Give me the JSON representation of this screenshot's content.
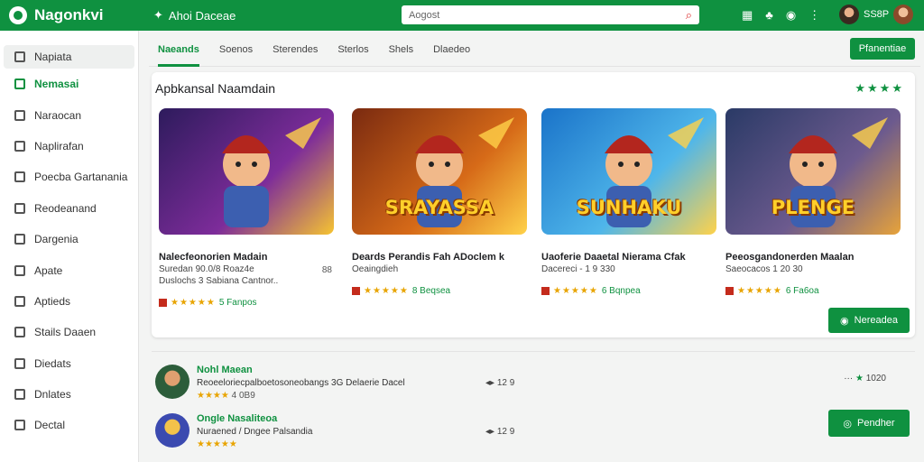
{
  "app": {
    "title": "Nagonkvi"
  },
  "topbar": {
    "crumb_label": "Ahoi Daceae",
    "search_placeholder": "Aogost",
    "user_label": "SS8P"
  },
  "sidebar": {
    "items": [
      {
        "label": "Napiata",
        "icon": "grid-icon"
      },
      {
        "label": "Nemasai",
        "icon": "apps-icon"
      },
      {
        "label": "Naraocan",
        "icon": "tv-icon"
      },
      {
        "label": "Naplirafan",
        "icon": "book-icon"
      },
      {
        "label": "Poecba Gartanania",
        "icon": "tag-icon"
      },
      {
        "label": "Reodeanand",
        "icon": "user-icon"
      },
      {
        "label": "Dargenia",
        "icon": "chart-icon"
      },
      {
        "label": "Apate",
        "icon": "mail-icon"
      },
      {
        "label": "Aptieds",
        "icon": "circle-icon"
      },
      {
        "label": "Stails Daaen",
        "icon": "bag-icon"
      },
      {
        "label": "Diedats",
        "icon": "shield-icon"
      },
      {
        "label": "Dnlates",
        "icon": "flag-icon"
      },
      {
        "label": "Dectal",
        "icon": "pen-icon"
      }
    ]
  },
  "tabs": [
    {
      "label": "Naeands"
    },
    {
      "label": "Soenos"
    },
    {
      "label": "Sterendes"
    },
    {
      "label": "Sterlos"
    },
    {
      "label": "Shels"
    },
    {
      "label": "Dlaedeo"
    }
  ],
  "header_button": "Pfanentiae",
  "section": {
    "title": "Apbkansal Naamdain",
    "stars": "★★★★"
  },
  "cards": [
    {
      "art_title": "",
      "name": "Nalecfeonorien Madain",
      "sub1": "Suredan 90.0/8 Roaz4e",
      "sub2": "Duslochs 3 Sabiana Cantnor..",
      "side": "88",
      "stars": "★★★★★",
      "rating": "5 Fanpos",
      "thumb_colors": [
        "#2d1b5c",
        "#7d2c9a",
        "#f6c431"
      ]
    },
    {
      "art_title": "SRAYASSA",
      "name": "Deards Perandis Fah ADoclem k",
      "sub1": "Oeaingdieh",
      "sub2": "",
      "side": "",
      "stars": "★★★★★",
      "rating": "8 Beqsea",
      "thumb_colors": [
        "#7a2a10",
        "#d66a18",
        "#ffd24a"
      ]
    },
    {
      "art_title": "SUNHAKU",
      "name": "Uaoferie Daaetal Nierama Cfak",
      "sub1": "Dacereci - 1  9 330",
      "sub2": "",
      "side": "",
      "stars": "★★★★★",
      "rating": "6 Bqnpea",
      "thumb_colors": [
        "#1a73c9",
        "#4fb6ea",
        "#ffd24a"
      ]
    },
    {
      "art_title": "PLENGE",
      "name": "Peeosgandonerden Maalan",
      "sub1": "Saeocacos  1  20 30",
      "sub2": "",
      "side": "",
      "stars": "★★★★★",
      "rating": "6 Fa6oa",
      "thumb_colors": [
        "#2a3a66",
        "#6c5a8e",
        "#e7a33a"
      ]
    }
  ],
  "section_button": "Nereadea",
  "list": [
    {
      "title": "Nohl Maean",
      "desc": "Reoeeloriecpalboetosoneobangs 3G Delaerie Dacel",
      "meta": "12 9",
      "rating": "4 0B9",
      "right": "1020",
      "stars": "★★★★",
      "button": ""
    },
    {
      "title": "Ongle Nasaliteoa",
      "desc": "Nuraened / Dngee Palsandia",
      "meta": "12 9",
      "rating": "",
      "right": "",
      "stars": "★★★★★",
      "button": "Pendher"
    }
  ],
  "colors": {
    "accent": "#0f9140",
    "star": "#e8a400"
  }
}
